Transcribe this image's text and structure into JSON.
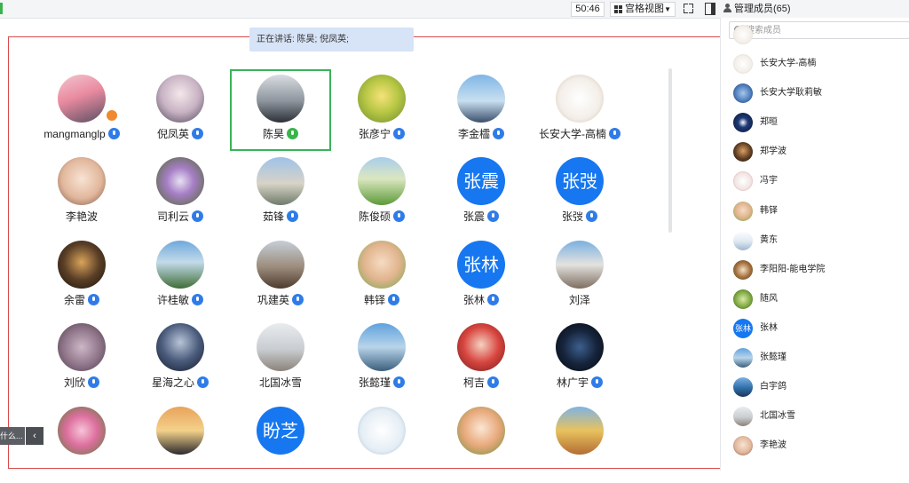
{
  "toolbar": {
    "timer": "50:46",
    "view_label": "宫格视图",
    "manage_members": "管理成员(65)"
  },
  "banner": {
    "speaking": "正在讲话: 陈昊; 倪凤英;"
  },
  "grid": {
    "tiles": [
      {
        "name": "mangmanglp",
        "mic": "normal",
        "avatar": "photo-family",
        "badge": true
      },
      {
        "name": "倪凤英",
        "mic": "normal",
        "avatar": "photo-anime-girl"
      },
      {
        "name": "陈昊",
        "mic": "talking",
        "avatar": "photo-car",
        "active": true
      },
      {
        "name": "张彦宁",
        "mic": "normal",
        "avatar": "photo-flower-yellow"
      },
      {
        "name": "李金櫺",
        "mic": "normal",
        "avatar": "photo-sea-sunset"
      },
      {
        "name": "长安大学-高楠",
        "mic": "normal",
        "avatar": "photo-family-cartoon"
      },
      {
        "name": "李艳波",
        "mic": "none",
        "avatar": "photo-girl-drawing"
      },
      {
        "name": "司利云",
        "mic": "normal",
        "avatar": "photo-bouquet"
      },
      {
        "name": "茹锋",
        "mic": "normal",
        "avatar": "photo-columns"
      },
      {
        "name": "陈俊硕",
        "mic": "normal",
        "avatar": "photo-lawn"
      },
      {
        "name": "张震",
        "mic": "normal",
        "avatar_text": "张震"
      },
      {
        "name": "张弢",
        "mic": "normal",
        "avatar_text": "张弢"
      },
      {
        "name": "余雷",
        "mic": "normal",
        "avatar": "photo-night-gate"
      },
      {
        "name": "许桂敏",
        "mic": "normal",
        "avatar": "photo-mountains"
      },
      {
        "name": "巩建英",
        "mic": "normal",
        "avatar": "photo-pagoda"
      },
      {
        "name": "韩铎",
        "mic": "normal",
        "avatar": "photo-baby"
      },
      {
        "name": "张林",
        "mic": "normal",
        "avatar_text": "张林"
      },
      {
        "name": "刘泽",
        "mic": "none",
        "avatar": "photo-person-rock"
      },
      {
        "name": "刘欣",
        "mic": "normal",
        "avatar": "photo-calligraphy"
      },
      {
        "name": "星海之心",
        "mic": "normal",
        "avatar": "photo-warrior"
      },
      {
        "name": "北国冰雪",
        "mic": "none",
        "avatar": "photo-snow"
      },
      {
        "name": "张懿瑾",
        "mic": "normal",
        "avatar": "photo-jump"
      },
      {
        "name": "柯吉",
        "mic": "normal",
        "avatar": "photo-child-red"
      },
      {
        "name": "林广宇",
        "mic": "normal",
        "avatar": "photo-night-blue"
      },
      {
        "name": "",
        "mic": "none",
        "avatar": "photo-pink-flowers"
      },
      {
        "name": "",
        "mic": "none",
        "avatar": "photo-sunset-field"
      },
      {
        "name": "",
        "mic": "none",
        "avatar_text": "盼芝"
      },
      {
        "name": "",
        "mic": "none",
        "avatar": "photo-fish-cartoon"
      },
      {
        "name": "",
        "mic": "none",
        "avatar": "photo-cartoon-girl"
      },
      {
        "name": "",
        "mic": "none",
        "avatar": "photo-autumn-tree"
      }
    ]
  },
  "side_tab": {
    "text": "什么...",
    "arrow": "‹"
  },
  "member_panel": {
    "search_placeholder": "搜索成员",
    "members": [
      {
        "name": "",
        "avatar": "photo-family-cartoon"
      },
      {
        "name": "长安大学-高楠",
        "avatar": "photo-family-cartoon"
      },
      {
        "name": "长安大学耿莉敏",
        "avatar": "photo-blue-abstract"
      },
      {
        "name": "郑晅",
        "avatar": "photo-cookie-monster"
      },
      {
        "name": "郑学波",
        "avatar": "photo-dark-portrait"
      },
      {
        "name": "冯宇",
        "avatar": "photo-light-figure"
      },
      {
        "name": "韩铎",
        "avatar": "photo-baby"
      },
      {
        "name": "黄东",
        "avatar": "photo-building-light"
      },
      {
        "name": "李阳阳-能电学院",
        "avatar": "photo-wreath"
      },
      {
        "name": "随风",
        "avatar": "photo-green-leaves"
      },
      {
        "name": "张林",
        "avatar_text": "张林"
      },
      {
        "name": "张懿瑾",
        "avatar": "photo-jump"
      },
      {
        "name": "白宇鸽",
        "avatar": "photo-lake"
      },
      {
        "name": "北国冰雪",
        "avatar": "photo-snow"
      },
      {
        "name": "李艳波",
        "avatar": "photo-girl-drawing"
      }
    ]
  },
  "colors": {
    "accent_blue": "#1677f0",
    "mic_blue": "#2f7ce8",
    "talking_green": "#39b54a",
    "active_border": "#38b45a",
    "frame_red": "#d94a4a",
    "banner_bg": "#d7e3f6"
  }
}
